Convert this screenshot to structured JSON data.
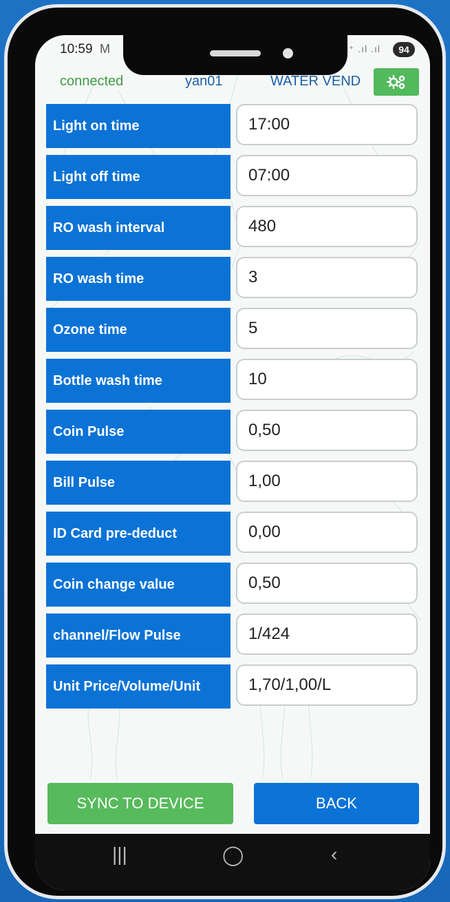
{
  "status_bar": {
    "time": "10:59",
    "mail_icon": "M",
    "signal_text": "⁺ .ıl .ıl",
    "battery": "94"
  },
  "app_bar": {
    "connection_status": "connected",
    "username": "yan01",
    "app_name": "WATER VEND",
    "settings_icon": "gears-icon"
  },
  "settings": [
    {
      "label": "Light on time",
      "value": "17:00"
    },
    {
      "label": "Light off time",
      "value": "07:00"
    },
    {
      "label": "RO wash interval",
      "value": "480"
    },
    {
      "label": "RO wash time",
      "value": "3"
    },
    {
      "label": "Ozone time",
      "value": "5"
    },
    {
      "label": "Bottle wash time",
      "value": "10"
    },
    {
      "label": "Coin Pulse",
      "value": "0,50"
    },
    {
      "label": "Bill Pulse",
      "value": "1,00"
    },
    {
      "label": "ID Card pre-deduct",
      "value": "0,00"
    },
    {
      "label": "Coin change value",
      "value": "0,50"
    },
    {
      "label": "channel/Flow Pulse",
      "value": "1/424"
    },
    {
      "label": "Unit Price/Volume/Unit",
      "value": "1,70/1,00/L"
    }
  ],
  "buttons": {
    "sync": "SYNC TO DEVICE",
    "back": "BACK"
  },
  "colors": {
    "primary_blue": "#0b73d6",
    "accent_green": "#57ba5c",
    "connected_green": "#3f9b44",
    "header_blue": "#1a5fa6"
  },
  "nav_bar": {
    "recents": "|||",
    "home": "◯",
    "back": "‹"
  }
}
